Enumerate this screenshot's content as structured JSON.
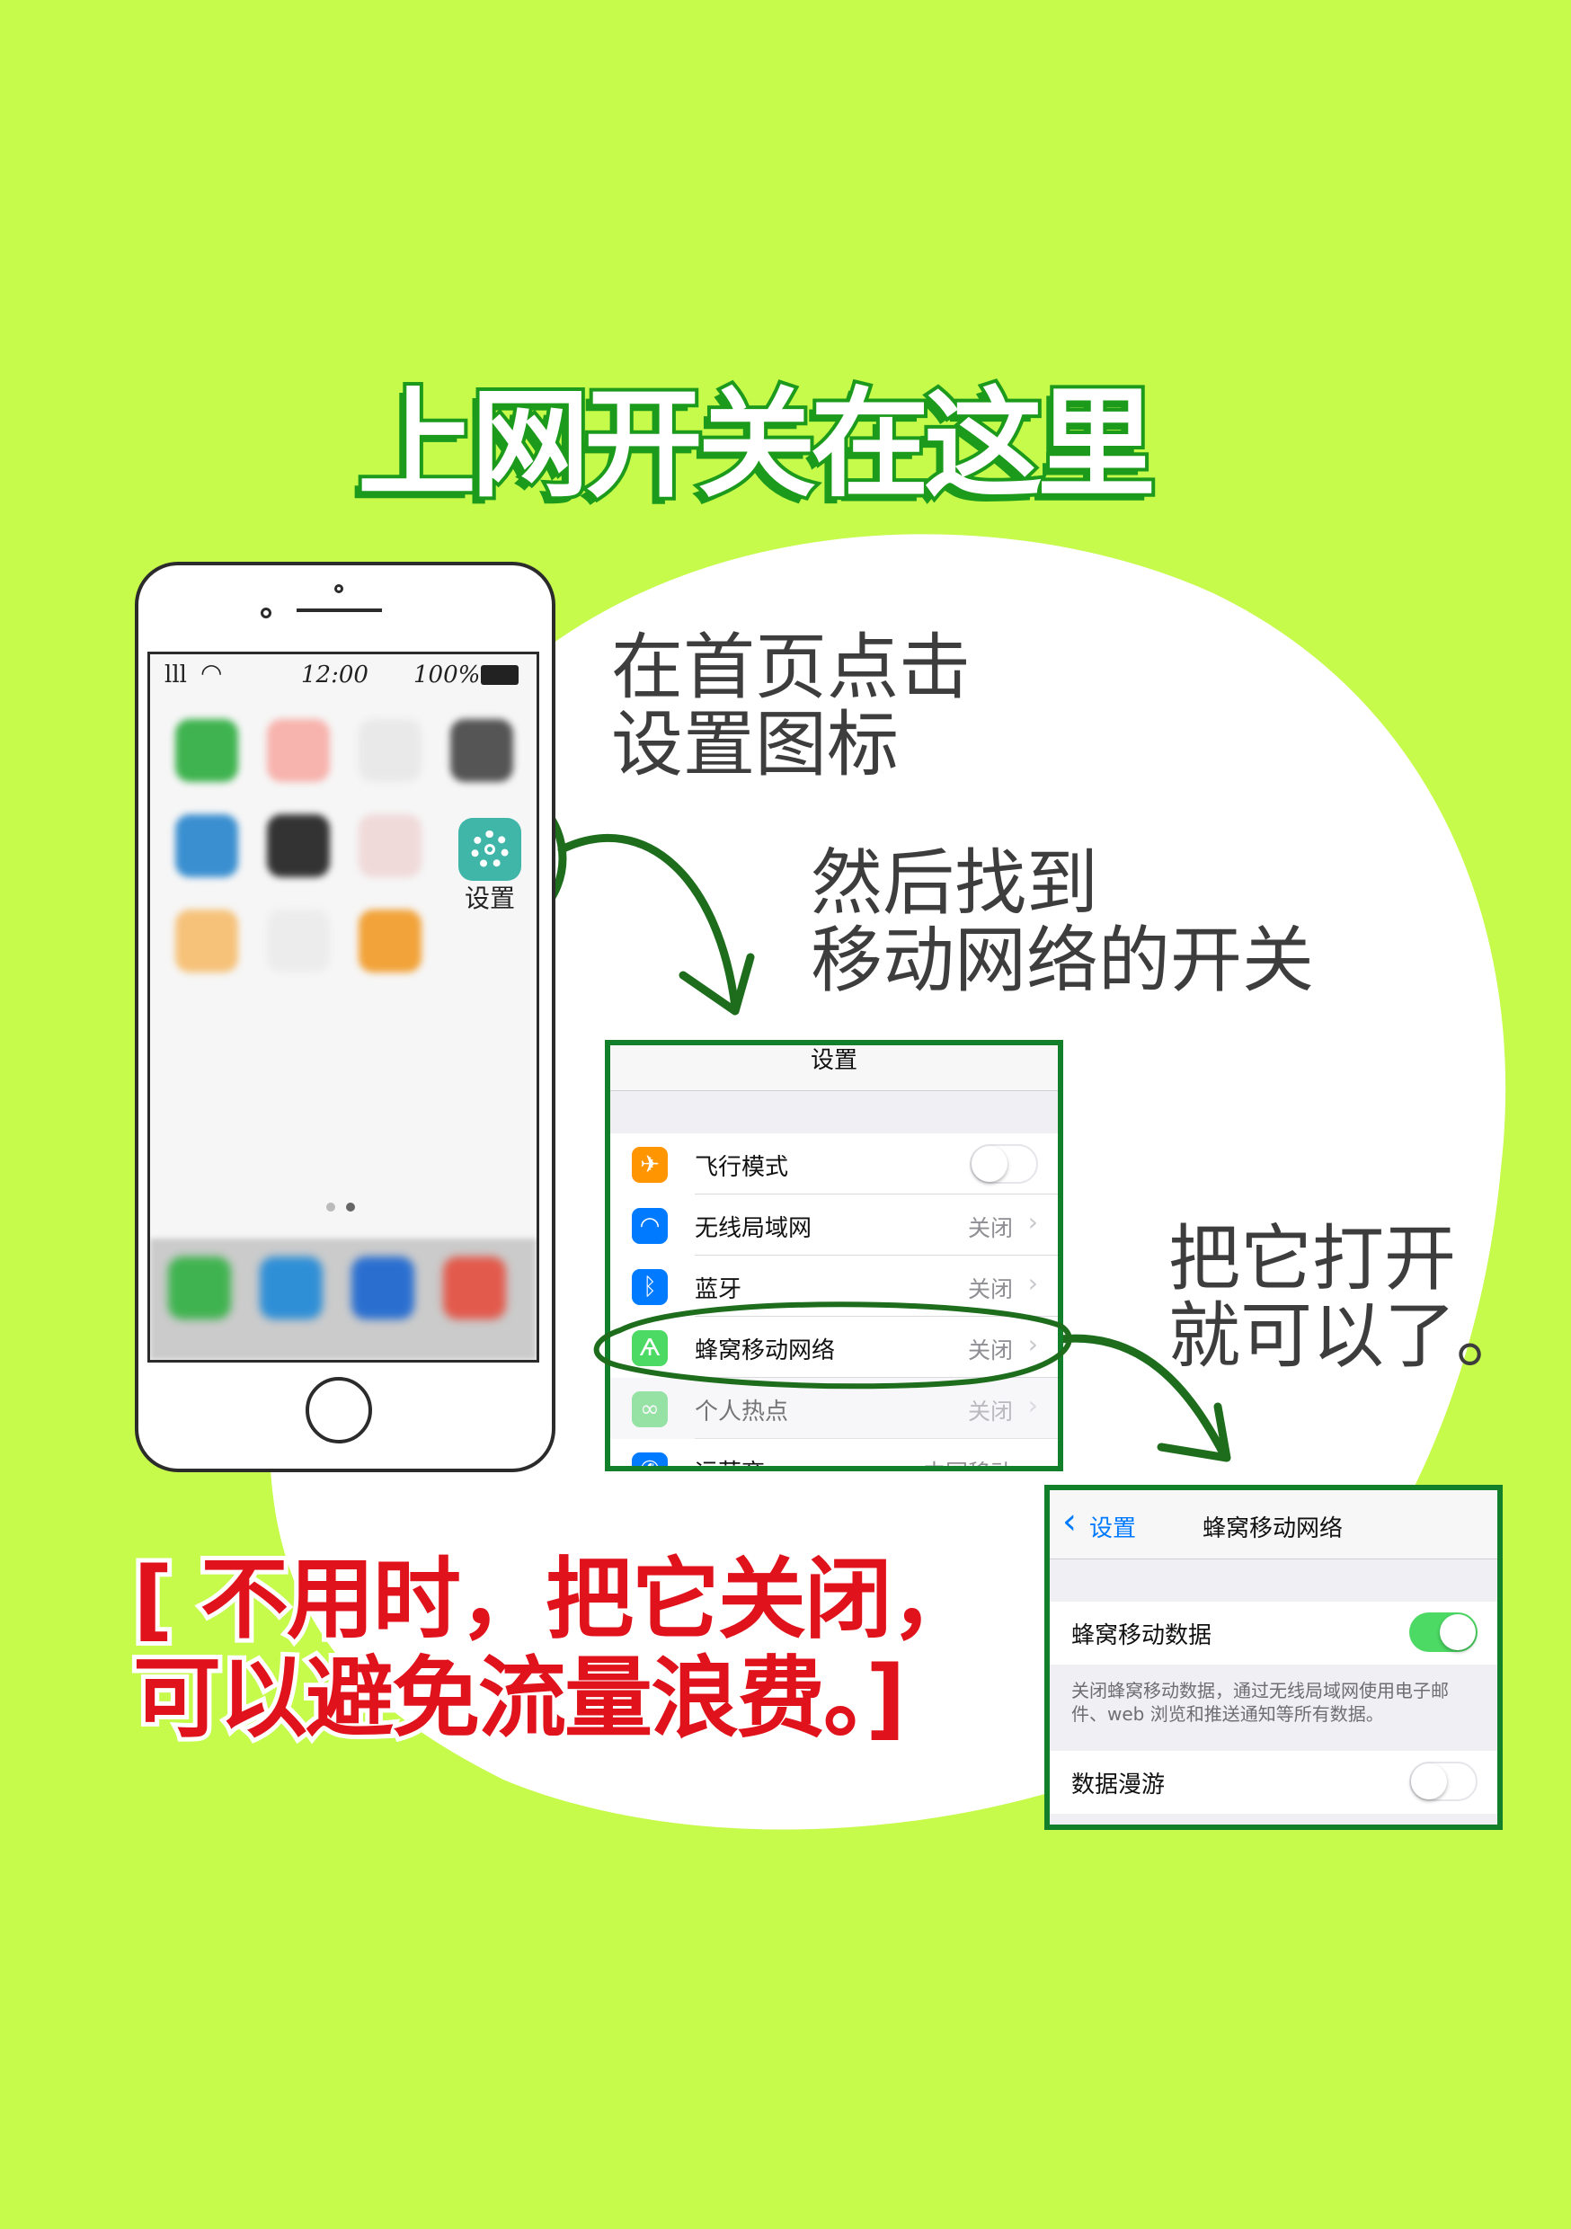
{
  "title": "上网开关在这里",
  "captions": {
    "step1_line1": "在首页点击",
    "step1_line2": "设置图标",
    "step2_line1": "然后找到",
    "step2_line2": "移动网络的开关",
    "step3_line1": "把它打开",
    "step3_line2": "就可以了。"
  },
  "note": {
    "line1": "[ 不用时，把它关闭，",
    "line2": "可以避免流量浪费。]"
  },
  "phone": {
    "time": "12:00",
    "battery": "100%",
    "settings_icon_label": "设置"
  },
  "settings_panel": {
    "header": "设置",
    "rows": [
      {
        "label": "飞行模式",
        "value": "",
        "icon": "airplane-icon",
        "color": "#ff9500"
      },
      {
        "label": "无线局域网",
        "value": "关闭",
        "icon": "wifi-icon",
        "color": "#007aff"
      },
      {
        "label": "蓝牙",
        "value": "关闭",
        "icon": "bluetooth-icon",
        "color": "#007aff"
      },
      {
        "label": "蜂窝移动网络",
        "value": "关闭",
        "icon": "antenna-icon",
        "color": "#4cd964"
      },
      {
        "label": "个人热点",
        "value": "关闭",
        "icon": "hotspot-icon",
        "color": "#4cd964"
      },
      {
        "label": "运营商",
        "value": "中国移动",
        "icon": "phone-icon",
        "color": "#007aff"
      }
    ]
  },
  "cellular_panel": {
    "back_label": "设置",
    "header": "蜂窝移动网络",
    "cellular_data_label": "蜂窝移动数据",
    "cellular_data_on": true,
    "description": "关闭蜂窝移动数据，通过无线局域网使用电子邮件、web 浏览和推送通知等所有数据。",
    "roaming_label": "数据漫游",
    "roaming_on": false
  },
  "colors": {
    "background": "#c6fa4b",
    "accent_green": "#1c9a1c",
    "warning_red": "#e0121b"
  }
}
